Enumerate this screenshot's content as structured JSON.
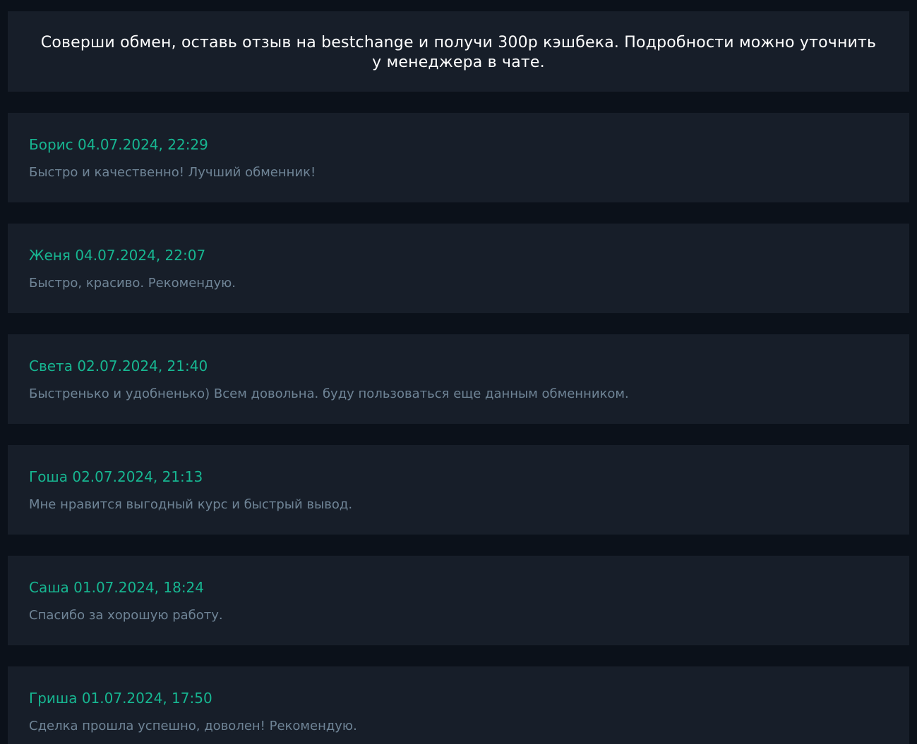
{
  "banner": {
    "text": "Соверши обмен, оставь отзыв на bestchange и получи 300р кэшбека. Подробности можно уточнить у менеджера в чате."
  },
  "colors": {
    "page_background": "#0b111a",
    "card_background": "#171e29",
    "accent": "#17b691",
    "muted_text": "#6f8496",
    "banner_text": "#ffffff"
  },
  "reviews": [
    {
      "author": "Борис",
      "datetime": "04.07.2024, 22:29",
      "text": "Быстро и качественно! Лучший обменник!"
    },
    {
      "author": "Женя",
      "datetime": "04.07.2024, 22:07",
      "text": "Быстро, красиво. Рекомендую."
    },
    {
      "author": "Света",
      "datetime": "02.07.2024, 21:40",
      "text": "Быстренько и удобненько) Всем довольна. буду пользоваться еще данным обменником."
    },
    {
      "author": "Гоша",
      "datetime": "02.07.2024, 21:13",
      "text": "Мне нравится выгодный курс и быстрый вывод."
    },
    {
      "author": "Саша",
      "datetime": "01.07.2024, 18:24",
      "text": "Спасибо за хорошую работу."
    },
    {
      "author": "Гриша",
      "datetime": "01.07.2024, 17:50",
      "text": "Сделка прошла успешно, доволен! Рекомендую."
    }
  ]
}
